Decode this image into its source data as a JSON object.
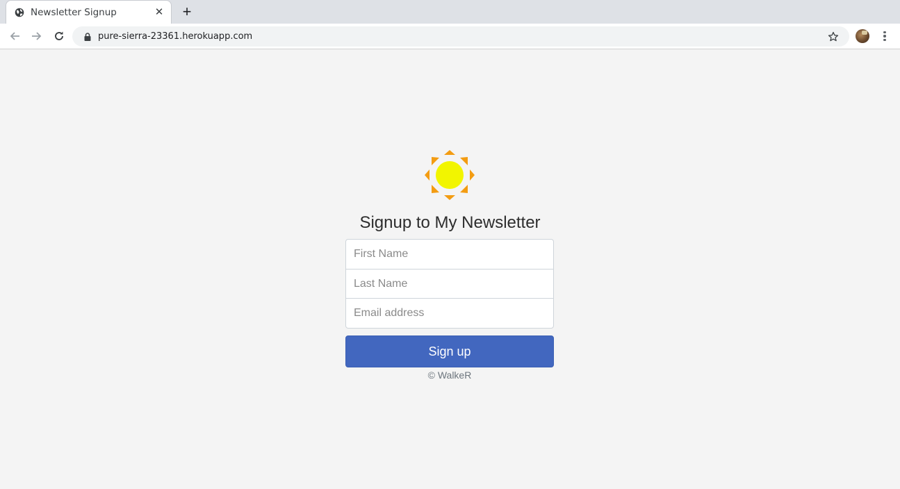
{
  "browser": {
    "tab_title": "Newsletter Signup",
    "tab_close": "✕",
    "new_tab": "+",
    "url": "pure-sierra-23361.herokuapp.com"
  },
  "page": {
    "heading": "Signup to My Newsletter",
    "fields": {
      "first_name_placeholder": "First Name",
      "last_name_placeholder": "Last Name",
      "email_placeholder": "Email address"
    },
    "submit_label": "Sign up",
    "footer": "© WalkeR"
  },
  "colors": {
    "button": "#4267bf",
    "background": "#f4f4f4",
    "sun": "#f2f500",
    "sun_rays": "#f39c12"
  },
  "icons": [
    "globe-icon",
    "close-icon",
    "plus-icon",
    "back-arrow-icon",
    "forward-arrow-icon",
    "reload-icon",
    "lock-icon",
    "star-icon",
    "avatar",
    "more-menu-icon",
    "sun-logo-icon"
  ]
}
